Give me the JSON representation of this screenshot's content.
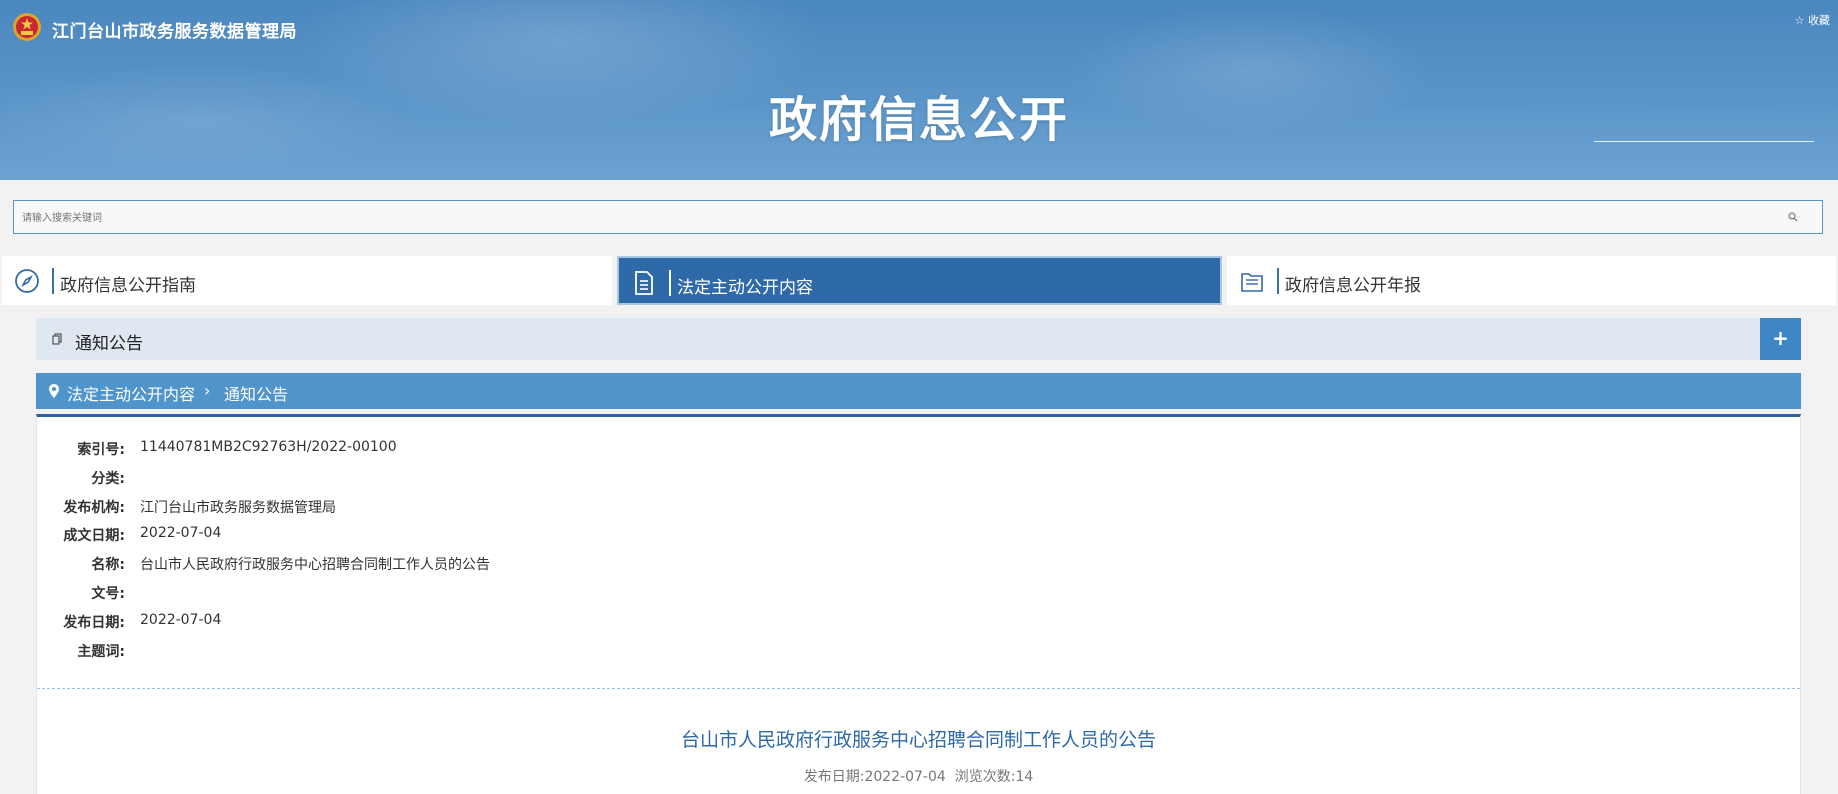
{
  "header": {
    "site_name": "江门台山市政务服务数据管理局",
    "favorite": "☆ 收藏",
    "title": "政府信息公开"
  },
  "search": {
    "placeholder": "请输入搜索关键词"
  },
  "tabs": [
    {
      "label": "政府信息公开指南",
      "icon": "compass-icon",
      "active": false
    },
    {
      "label": "法定主动公开内容",
      "icon": "document-icon",
      "active": true
    },
    {
      "label": "政府信息公开年报",
      "icon": "folder-icon",
      "active": false
    }
  ],
  "section": {
    "title": "通知公告",
    "expand_label": "+"
  },
  "breadcrumb": {
    "items": [
      "法定主动公开内容",
      "通知公告"
    ],
    "separator": "›"
  },
  "meta": [
    {
      "key": "索引号:",
      "value": "11440781MB2C92763H/2022-00100"
    },
    {
      "key": "分类:",
      "value": ""
    },
    {
      "key": "发布机构:",
      "value": "江门台山市政务服务数据管理局"
    },
    {
      "key": "成文日期:",
      "value": "2022-07-04"
    },
    {
      "key": "名称:",
      "value": "台山市人民政府行政服务中心招聘合同制工作人员的公告"
    },
    {
      "key": "文号:",
      "value": ""
    },
    {
      "key": "发布日期:",
      "value": "2022-07-04"
    },
    {
      "key": "主题词:",
      "value": ""
    }
  ],
  "article": {
    "title": "台山市人民政府行政服务中心招聘合同制工作人员的公告",
    "publish_label": "发布日期:",
    "publish_date": "2022-07-04",
    "views_label": "浏览次数:",
    "views": "14"
  },
  "colors": {
    "header": "#5b95c8",
    "active_tab": "#2f6aa8",
    "breadcrumb": "#4f94cb",
    "article_title": "#2e6aa8"
  }
}
